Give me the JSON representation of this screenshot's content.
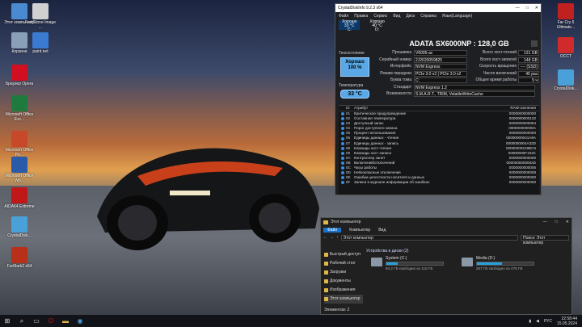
{
  "desktop": {
    "icons_left": [
      {
        "label": "Этот компьютер",
        "icon": "computer-icon",
        "color": "#4a8ad0"
      },
      {
        "label": "FastStone Image ...",
        "icon": "faststone-icon",
        "color": "#d0d0d0"
      },
      {
        "label": "Корзина",
        "icon": "recycle-bin-icon",
        "color": "#8aa0b8"
      },
      {
        "label": "paint.net",
        "icon": "paintnet-icon",
        "color": "#3a7ad0"
      },
      {
        "label": "Браузер Opera",
        "icon": "opera-icon",
        "color": "#d01020"
      },
      {
        "label": "Microsoft Office Exc...",
        "icon": "excel-icon",
        "color": "#1f7a3e"
      },
      {
        "label": "Microsoft Office Po...",
        "icon": "powerpoint-icon",
        "color": "#c8482a"
      },
      {
        "label": "Microsoft Office Wo...",
        "icon": "word-icon",
        "color": "#2a5aa8"
      },
      {
        "label": "AIDA64 Extreme",
        "icon": "aida64-icon",
        "color": "#c01818"
      },
      {
        "label": "CrystalDisk...",
        "icon": "crystaldisk-icon",
        "color": "#4aa0d8"
      },
      {
        "label": "FurMark2 x64",
        "icon": "furmark-icon",
        "color": "#b83018"
      }
    ],
    "icons_right": [
      {
        "label": "Far Cry 6 Ultimate...",
        "icon": "farcry-icon",
        "color": "#c02020"
      },
      {
        "label": "OCCT",
        "icon": "occt-icon",
        "color": "#d02a2a"
      },
      {
        "label": "CrystalDisk...",
        "icon": "crystaldisk-icon",
        "color": "#4aa0d8"
      }
    ]
  },
  "cdi": {
    "title": "CrystalDiskInfo 9.2.3 x64",
    "controls": [
      "—",
      "□",
      "✕"
    ],
    "menu": [
      "Файл",
      "Правка",
      "Сервис",
      "Вид",
      "Диск",
      "Справка",
      "Язык(Language)"
    ],
    "disk_tabs": [
      {
        "status": "Хорошо",
        "temp": "33 °C",
        "letter": "C:"
      },
      {
        "status": "Хорошо",
        "temp": "40 °C",
        "letter": "D:"
      }
    ],
    "drive_title": "ADATA SX6000NP : 128,0 GB",
    "health_label": "Техсостояние",
    "health_status": "Хорошо",
    "health_percent": "100 %",
    "temp_label": "Температура",
    "temp_value": "33 °C",
    "info_left": [
      {
        "label": "Прошивка",
        "value": "V6005-ac"
      },
      {
        "label": "Серийный номер",
        "value": "2J2620059825"
      },
      {
        "label": "Интерфейс",
        "value": "NVM Express"
      },
      {
        "label": "Режим передачи",
        "value": "PCIe 3.0 x2 | PCIe 3.0 x2"
      },
      {
        "label": "Буква тома",
        "value": "C:"
      },
      {
        "label": "Стандарт",
        "value": "NVM Express 1.2"
      },
      {
        "label": "Возможности",
        "value": "S.M.A.R.T., TRIM, VolatileWriteCache"
      }
    ],
    "info_right": [
      {
        "label": "Всего хост-чтений",
        "value": "131 GB"
      },
      {
        "label": "Всего хост-записей",
        "value": "148 GB"
      },
      {
        "label": "Скорость вращения",
        "value": "---- (SSD)"
      },
      {
        "label": "Число включений",
        "value": "45 раз"
      },
      {
        "label": "Общее время работы",
        "value": "5 ч"
      }
    ],
    "smart_headers": {
      "id": "ID",
      "attr": "Атрибут",
      "raw": "RAW-значения"
    },
    "smart_rows": [
      {
        "id": "01",
        "attr": "Критическое предупреждение",
        "raw": "0000000000000"
      },
      {
        "id": "02",
        "attr": "Составная температура",
        "raw": "0000000000132"
      },
      {
        "id": "03",
        "attr": "Доступный запас",
        "raw": "0000000000064"
      },
      {
        "id": "04",
        "attr": "Порог доступного запаса",
        "raw": "000000000000A"
      },
      {
        "id": "05",
        "attr": "Процент использования",
        "raw": "0000000000000"
      },
      {
        "id": "06",
        "attr": "Единицы данных - чтение",
        "raw": "00000000041A8A"
      },
      {
        "id": "07",
        "attr": "Единицы данных - запись",
        "raw": "0000000004A32D"
      },
      {
        "id": "08",
        "attr": "Команды хост-чтения",
        "raw": "00000000219BC5"
      },
      {
        "id": "09",
        "attr": "Команды хост-записи",
        "raw": "00000000F153C"
      },
      {
        "id": "0A",
        "attr": "Контроллер занят",
        "raw": "0000000000000"
      },
      {
        "id": "0B",
        "attr": "Включений/отключений",
        "raw": "0000000000002D"
      },
      {
        "id": "0C",
        "attr": "Часы работы",
        "raw": "0000000000005"
      },
      {
        "id": "0D",
        "attr": "Небезопасные отключения",
        "raw": "0000000000008"
      },
      {
        "id": "0E",
        "attr": "Ошибки целостности носителя и данных",
        "raw": "0000000000000"
      },
      {
        "id": "0F",
        "attr": "Записи в журнале информации об ошибках",
        "raw": "0000000000000"
      }
    ]
  },
  "explorer": {
    "title": "Этот компьютер",
    "controls": [
      "—",
      "□",
      "✕"
    ],
    "ribbon": [
      "Файл",
      "Компьютер",
      "Вид"
    ],
    "address": "Этот компьютер",
    "search_placeholder": "Поиск: Этот компьютер",
    "nav": [
      {
        "label": "Быстрый доступ",
        "selected": false
      },
      {
        "label": "Рабочий стол",
        "selected": false
      },
      {
        "label": "Загрузки",
        "selected": false
      },
      {
        "label": "Документы",
        "selected": false
      },
      {
        "label": "Изображения",
        "selected": false
      },
      {
        "label": "Этот компьютер",
        "selected": true
      }
    ],
    "section_title": "Устройства и диски (2)",
    "drives": [
      {
        "name": "System (C:)",
        "free": "94,2 ГБ свободно из 118 ГБ",
        "used_fraction": 0.2
      },
      {
        "name": "Media (D:)",
        "free": "267 ГБ свободно из 476 ГБ",
        "used_fraction": 0.44
      }
    ],
    "status": "Элементов: 2"
  },
  "taskbar": {
    "time": "22:58:44",
    "date": "15.05.2024",
    "lang": "РУС"
  }
}
